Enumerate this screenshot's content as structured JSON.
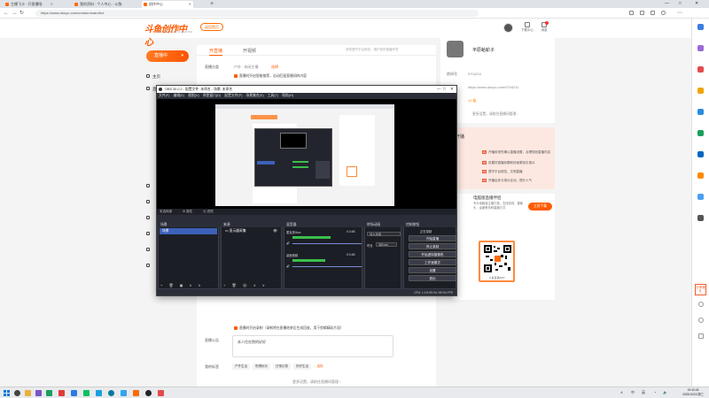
{
  "browser": {
    "tabs": [
      {
        "title": "主播飞卡 · 开直播啦"
      },
      {
        "title": "我的资料 · 个人中心 · 斗鱼"
      },
      {
        "title": "创作中心"
      }
    ],
    "url": "https://www.douyu.com/creator/main/live",
    "new_tab": "+",
    "min": "—",
    "max": "□",
    "close": "✕"
  },
  "site": {
    "logo_text": "斗鱼创作中心",
    "logo_sub": "DOUYU CREATOR CENTER",
    "back_button": "返回首页",
    "header_tools": [
      {
        "label": "下载中心",
        "icon": "download-icon"
      },
      {
        "label": "消息",
        "icon": "bell-icon"
      }
    ]
  },
  "sidebar": {
    "live_button": "直播中",
    "caret": "▾",
    "items": [
      {
        "label": "主页"
      },
      {
        "label": "直播"
      }
    ]
  },
  "panel": {
    "tabs": [
      {
        "label": "开直播"
      },
      {
        "label": "开视频"
      }
    ],
    "top_tip": "请您遵守平台规范，维护良好直播环境",
    "category_label": "直播分类",
    "category_value": "户外 · 休闲主播",
    "category_action": "选择",
    "auto_check_text": "直播时开启智能推荐，自动匹配直播间的内容",
    "record_check_text": "直播时开启录制（录制将在直播结束后生成回放，用于剪辑精彩片段）",
    "notice_label": "直播公告",
    "notice_value": "本人住在院的好好",
    "tags_label": "我的标签",
    "tags": [
      "户外生活",
      "吃喝玩乐",
      "日常记录",
      "好好生活"
    ],
    "tags_action": "…选择",
    "more_link": "更多设置，请前往直播间管理 ›"
  },
  "profile": {
    "name": "平原蛤蚧子",
    "room_label": "房间号",
    "room_value": "9704211",
    "link_label": "直播间",
    "link_value": "https://www.douyu.com/9704211",
    "level_label": "等级",
    "level_value": "12 级",
    "more_link": "更多设置，请前往直播间管理 ›"
  },
  "tips": {
    "header": "开播",
    "items": [
      {
        "num": "01",
        "text": "开播前请先确认直播设置，合理规划直播内容"
      },
      {
        "num": "02",
        "text": "设置好直播标题和封面更吸引观众"
      },
      {
        "num": "03",
        "text": "遵守平台规范，文明直播"
      },
      {
        "num": "04",
        "text": "开播后多与观众互动，提升人气"
      }
    ]
  },
  "download": {
    "title": "电脑版直播伴侣",
    "desc": "专为电脑端主播打造，支持游戏、摄像头、桌面等多种直播方式",
    "button": "立即下载",
    "qr_caption": "斗鱼直播APP"
  },
  "obs": {
    "title": "OBS 30.0.2 - 配置文件: 未命名 - 场景: 未命名",
    "min": "—",
    "max": "□",
    "close": "✕",
    "menus": [
      "文件(F)",
      "编辑(E)",
      "视图(V)",
      "停靠窗口(D)",
      "配置文件(P)",
      "场景集合(S)",
      "工具(T)",
      "帮助(H)"
    ],
    "source_bar": [
      "未选择源",
      "⚙ 属性",
      "▣ 滤镜"
    ],
    "docks": {
      "scenes": {
        "title": "场景",
        "items": [
          "场景"
        ],
        "footer": "+ 🗑 ▣ ∧ ∨"
      },
      "sources": {
        "title": "来源",
        "items": [
          "显示器采集"
        ],
        "footer": "+ 🗑 ⚙ ∧ ∨"
      },
      "mixer": {
        "title": "混音器",
        "channels": [
          {
            "name": "麦克风/Aux",
            "db": "0.0 dB",
            "level": 0.55
          },
          {
            "name": "桌面音频",
            "db": "0.0 dB",
            "level": 0.48
          }
        ]
      },
      "transitions": {
        "title": "转场动画",
        "type": "淡入淡出",
        "duration_label": "时长",
        "duration": "300 ms"
      },
      "controls": {
        "title": "控制按钮",
        "buttons": [
          "开始直播",
          "停止录制",
          "开始虚拟摄像机",
          "工作室模式",
          "设置",
          "退出"
        ],
        "status_text": "正在录制"
      }
    },
    "status": "CPU: 1.1%   59.94 / 59.94 FPS"
  },
  "edge_badge": "分享赚礼",
  "taskbar": {
    "time": "19:40:45",
    "date": "2025/10/15 周三",
    "tray": [
      "∧",
      "中",
      "英"
    ]
  }
}
